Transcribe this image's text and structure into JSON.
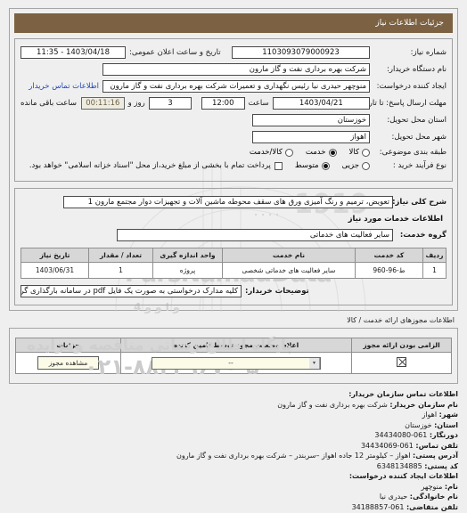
{
  "header": {
    "title": "جزئیات اطلاعات نیاز"
  },
  "form": {
    "need_number_label": "شماره نیاز:",
    "need_number_value": "1103093079000923",
    "announce_label": "تاریخ و ساعت اعلان عمومی:",
    "announce_value": "1403/04/18 - 11:35",
    "buyer_org_label": "نام دستگاه خریدار:",
    "buyer_org_value": "شرکت بهره برداری نفت و گاز مارون",
    "creator_label": "ایجاد کننده درخواست:",
    "creator_value": "منوچهر حیدری نیا رئیس نگهداری و تعمیرات شرکت بهره برداری نفت و گاز مارون",
    "contact_link": "اطلاعات تماس خریدار",
    "deadline_label": "مهلت ارسال پاسخ: تا تاریخ:",
    "deadline_date": "1403/04/21",
    "time_label": "ساعت",
    "deadline_time": "12:00",
    "days_value": "3",
    "days_label": "روز و",
    "countdown_value": "00:11:16",
    "remaining_label": "ساعت باقی مانده",
    "province_label": "استان محل تحویل:",
    "province_value": "خوزستان",
    "city_label": "شهر محل تحویل:",
    "city_value": "اهواز",
    "category_label": "طبقه بندی موضوعی:",
    "category_options": [
      {
        "label": "کالا",
        "selected": false
      },
      {
        "label": "خدمت",
        "selected": true
      },
      {
        "label": "کالا/خدمت",
        "selected": false
      }
    ],
    "process_label": "نوع فرآیند خرید :",
    "process_options": [
      {
        "label": "جزیی",
        "selected": false
      },
      {
        "label": "متوسط",
        "selected": true
      }
    ],
    "payment_checkbox_label": "پرداخت تمام با بخشی از مبلغ خرید،از محل \"اسناد خزانه اسلامی\" خواهد بود."
  },
  "summary": {
    "label": "شرح کلی نیاز:",
    "value": "تعویض، ترمیم و رنگ آمیزی ورق های سقف محوطه ماشین آلات و تجهیزات دوار مجتمع مارون 1",
    "services_heading": "اطلاعات خدمات مورد نیاز",
    "group_label": "گروه خدمت:",
    "group_value": "سایر فعالیت های خدماتی"
  },
  "service_table": {
    "columns": [
      "ردیف",
      "کد خدمت",
      "نام خدمت",
      "واحد اندازه گیری",
      "تعداد / مقدار",
      "تاریخ نیاز"
    ],
    "rows": [
      {
        "index": "1",
        "code": "ط-96-960",
        "name": "سایر فعالیت های خدماتی شخصی",
        "unit": "پروژه",
        "quantity": "1",
        "need_date": "1403/06/31"
      }
    ]
  },
  "buyer_notes": {
    "label": "توضیحات خریدار:",
    "value": "کلیه مدارک درخواستی به صورت یک فایل pdf در سامانه بارگذاری گردد."
  },
  "permits": {
    "caption": "اطلاعات مجوزهای ارائه خدمت / کالا",
    "columns": [
      "الزامی بودن ارائه مجوز",
      "اعلام وضعیت مجوز توسط تامین کننده",
      "جزئیات"
    ],
    "rows": [
      {
        "required_icon": "x-box-icon",
        "status_value": "--",
        "details_button": "مشاهده مجوز"
      }
    ]
  },
  "contact": {
    "heading": "اطلاعات تماس سازمان خریدار:",
    "items": [
      {
        "label": "نام سازمان خریدار:",
        "value": "شرکت بهره برداری نفت و گاز مارون"
      },
      {
        "label": "شهر:",
        "value": "اهواز"
      },
      {
        "label": "استان:",
        "value": "خوزستان"
      },
      {
        "label": "دورنگار:",
        "value": "34434080-061"
      },
      {
        "label": "تلفن تماس:",
        "value": "34434069-061"
      },
      {
        "label": "آدرس پستی:",
        "value": "اهواز – کیلومتر 12 جاده اهواز –سربندر – شرکت بهره برداری نفت و گاز مارون"
      },
      {
        "label": "کد پستی:",
        "value": "6348134885"
      }
    ],
    "creator_heading": "اطلاعات ایجاد کننده درخواست:",
    "creator_items": [
      {
        "label": "نام:",
        "value": "منوچهر"
      },
      {
        "label": "نام خانوادگی:",
        "value": "حیدری نیا"
      },
      {
        "label": "تلفن متقاضی:",
        "value": "34188857-061"
      }
    ]
  },
  "watermark": {
    "brand": "ParsNamadData",
    "site": "پایگاه اطلاع رسانی مناقصه ومزایده",
    "phone": "۰۲۱-۸۸۳۴۹۶۷۰-۵",
    "number": "1919",
    "arabic_small": "و ا و و 4"
  },
  "colors": {
    "title_bar": "#7c6242",
    "link": "#2147b8",
    "page_bg": "#efefef",
    "header_row": "#d7d7d7"
  }
}
